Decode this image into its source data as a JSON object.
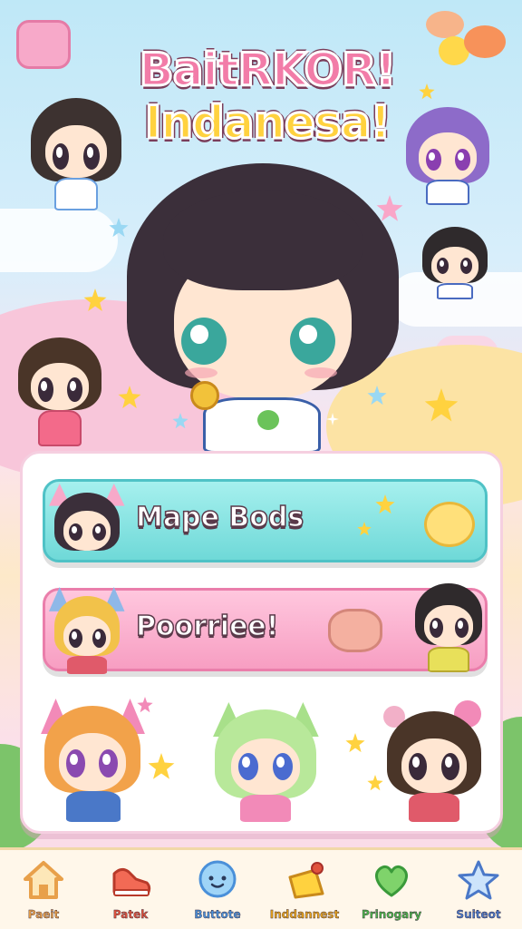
{
  "title": {
    "line1": "BaitRKOR!",
    "line2": "Indanesa!"
  },
  "menu": {
    "buttons": [
      {
        "label": "Mape Bods"
      },
      {
        "label": "Poorriee!"
      }
    ]
  },
  "tabbar": {
    "tabs": [
      {
        "label": "Paeit",
        "icon": "house-icon",
        "color": "#e8a04a"
      },
      {
        "label": "Patek",
        "icon": "sneaker-icon",
        "color": "#e0533d"
      },
      {
        "label": "Buttote",
        "icon": "bubble-face-icon",
        "color": "#4a90d9"
      },
      {
        "label": "Inddannest",
        "icon": "ribbon-icon",
        "color": "#e6a21c"
      },
      {
        "label": "Prinogary",
        "icon": "heart-icon",
        "color": "#4bb24b"
      },
      {
        "label": "Suiteot",
        "icon": "star-icon",
        "color": "#4a78c8"
      }
    ]
  },
  "colors": {
    "teal_button": "#6fd9d8",
    "pink_button": "#f79ec2",
    "panel_border": "#f5cfe0",
    "tabbar_bg": "#fff7ea"
  }
}
